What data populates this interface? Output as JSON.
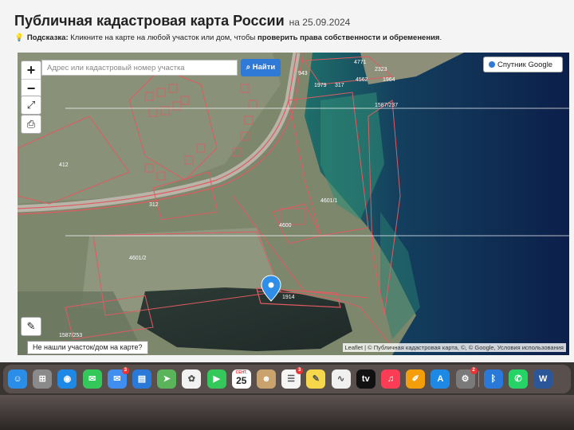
{
  "header": {
    "title": "Публичная кадастровая карта России",
    "date": "на 25.09.2024"
  },
  "hint": {
    "label": "Подсказка:",
    "text": "Кликните на карте на любой участок или дом, чтобы",
    "bold": "проверить права собственности и обременения",
    "end": "."
  },
  "map": {
    "search_placeholder": "Адрес или кадастровый номер участка",
    "find_label": "Найти",
    "layer_label": "Спутник Google",
    "zoom_in": "+",
    "zoom_out": "−",
    "not_found": "Не нашли участок/дом на карте?",
    "attribution": "Leaflet | © Публичная кадастровая карта, ©, © Google, Условия использования",
    "labels": [
      "412",
      "312",
      "4601/1",
      "4601/2",
      "4600",
      "1587/237",
      "1587/253",
      "1979",
      "317",
      "4562",
      "1964",
      "2323",
      "4771",
      "1914",
      "943"
    ]
  },
  "dock": {
    "calendar_month": "СЕНТ.",
    "calendar_day": "25",
    "apps": [
      {
        "name": "finder",
        "glyph": "☺",
        "color": "#2a8de8"
      },
      {
        "name": "launchpad",
        "glyph": "⊞",
        "color": "#8a8a8a"
      },
      {
        "name": "safari",
        "glyph": "◉",
        "color": "#1e88e5"
      },
      {
        "name": "messages",
        "glyph": "✉",
        "color": "#34c759"
      },
      {
        "name": "mail",
        "glyph": "✉",
        "color": "#3f8ef0",
        "badge": "3"
      },
      {
        "name": "keynote",
        "glyph": "▤",
        "color": "#2a79d8"
      },
      {
        "name": "maps",
        "glyph": "➤",
        "color": "#5ab55a"
      },
      {
        "name": "photos",
        "glyph": "✿",
        "color": "#f2f2f2"
      },
      {
        "name": "facetime",
        "glyph": "▶",
        "color": "#34c759"
      },
      {
        "name": "calendar",
        "glyph": "",
        "color": "#ffffff"
      },
      {
        "name": "contacts",
        "glyph": "☻",
        "color": "#c9a26d"
      },
      {
        "name": "reminders",
        "glyph": "☰",
        "color": "#f5f5f5",
        "badge": "3"
      },
      {
        "name": "notes",
        "glyph": "✎",
        "color": "#f6d64b"
      },
      {
        "name": "freeform",
        "glyph": "∿",
        "color": "#f0f0f0"
      },
      {
        "name": "apple-tv",
        "glyph": "tv",
        "color": "#111111"
      },
      {
        "name": "music",
        "glyph": "♫",
        "color": "#fa3c55"
      },
      {
        "name": "pages",
        "glyph": "✐",
        "color": "#f59e0b"
      },
      {
        "name": "app-store",
        "glyph": "A",
        "color": "#1e88e5"
      },
      {
        "name": "system-settings",
        "glyph": "⚙",
        "color": "#7a7a7a",
        "badge": "2"
      },
      {
        "name": "bluetooth",
        "glyph": "ᛒ",
        "color": "#2a79d8"
      },
      {
        "name": "whatsapp",
        "glyph": "✆",
        "color": "#25d366"
      },
      {
        "name": "word",
        "glyph": "W",
        "color": "#2b579a"
      }
    ]
  }
}
